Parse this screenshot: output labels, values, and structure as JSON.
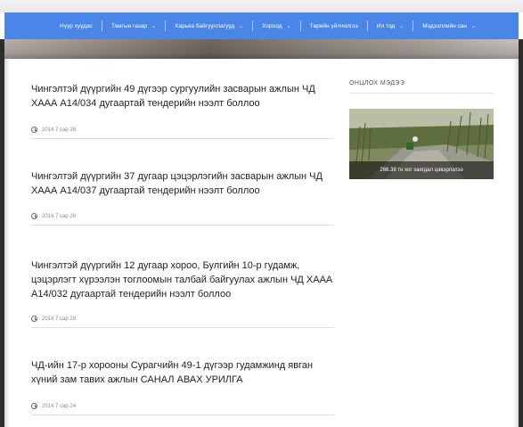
{
  "nav": {
    "items": [
      {
        "label": "Нүүр хуудас",
        "dropdown": false
      },
      {
        "label": "Тамгын газар",
        "dropdown": true
      },
      {
        "label": "Харьяа байгууллагууд",
        "dropdown": true
      },
      {
        "label": "Хороод",
        "dropdown": true
      },
      {
        "label": "Төрийн үйлчилгээ",
        "dropdown": false
      },
      {
        "label": "Ил тод",
        "dropdown": true
      },
      {
        "label": "Мэдээллийн сан",
        "dropdown": true
      }
    ],
    "color": "#4a86e8"
  },
  "articles": [
    {
      "title": "Чингэлтэй дүүргийн 49 дүгээр сургуулийн засварын ажлын ЧД ХААА А14/034 дугаартай тендерийн нээлт боллоо",
      "date": "2014 7 сар 28"
    },
    {
      "title": "Чингэлтэй дүүргийн 37 дугаар цэцэрлэгийн засварын ажлын ЧД ХААА А14/037 дугаартай тендерийн нээлт боллоо",
      "date": "2014 7 сар 28"
    },
    {
      "title": "Чингэлтэй дүүргийн 12 дугаар хороо, Булгийн 10-р гудамж, цэцэрлэгт хүрээлэн тоглоомын талбай байгуулах ажлын ЧД ХААА А14/032 дугаартай тендерийн нээлт боллоо",
      "date": "2014 7 сар 28"
    },
    {
      "title": "ЧД-ийн 17-р хорооны Сурагчийн 49-1 дүгээр гудамжинд явган хүний зам тавих ажлын САНАЛ АВАХ УРИЛГА",
      "date": "2014 7 сар 24"
    }
  ],
  "sidebar": {
    "title": "ОНЦЛОХ МЭДЭЭ",
    "featured_caption": "266.38 тн хог хаягдал цэвэрлэлээ"
  },
  "icons": {
    "date": "clock-icon",
    "dropdown": "chevron-down-icon"
  }
}
